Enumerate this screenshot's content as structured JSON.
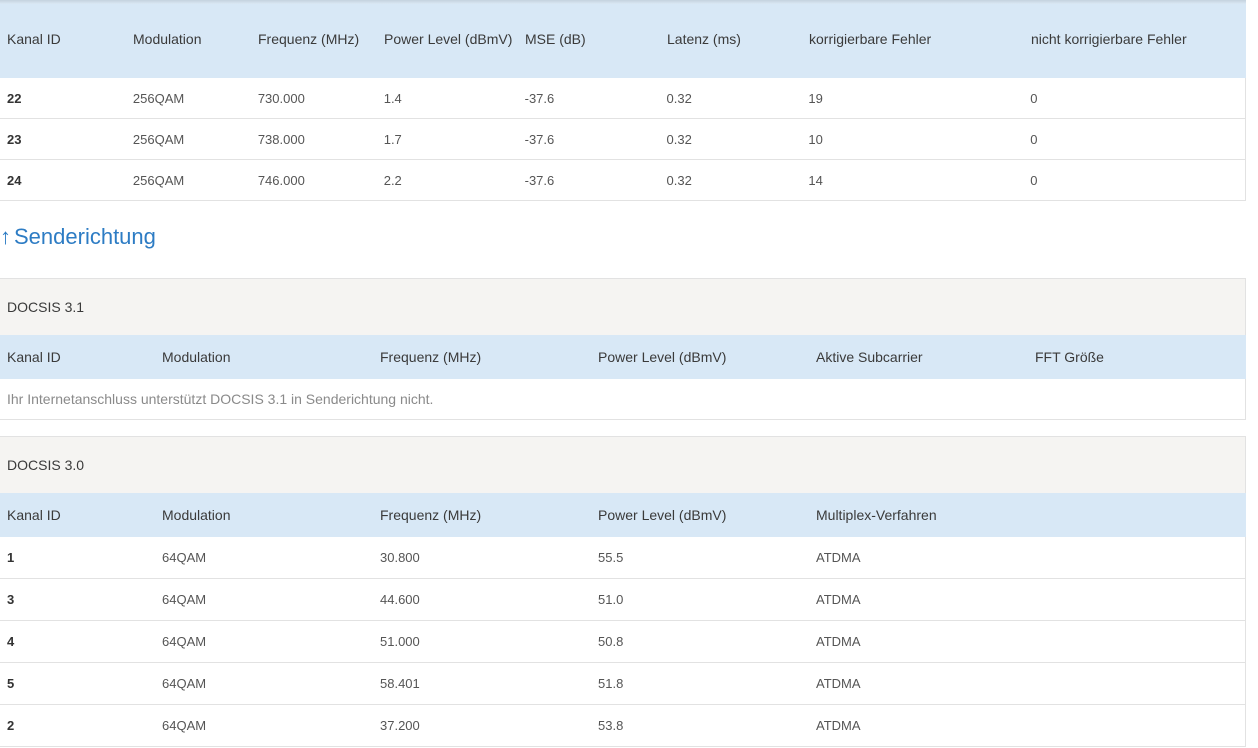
{
  "downstream": {
    "headers": [
      "Kanal ID",
      "Modulation",
      "Frequenz (MHz)",
      "Power Level (dBmV)",
      "MSE (dB)",
      "Latenz (ms)",
      "korrigierbare Fehler",
      "nicht korrigierbare Fehler"
    ],
    "rows": [
      [
        "22",
        "256QAM",
        "730.000",
        "1.4",
        "-37.6",
        "0.32",
        "19",
        "0"
      ],
      [
        "23",
        "256QAM",
        "738.000",
        "1.7",
        "-37.6",
        "0.32",
        "10",
        "0"
      ],
      [
        "24",
        "256QAM",
        "746.000",
        "2.2",
        "-37.6",
        "0.32",
        "14",
        "0"
      ]
    ]
  },
  "upstream": {
    "heading": "Senderichtung",
    "arrow_icon": "arrow-up-icon",
    "docsis31": {
      "title": "DOCSIS 3.1",
      "headers": [
        "Kanal ID",
        "Modulation",
        "Frequenz (MHz)",
        "Power Level (dBmV)",
        "Aktive Subcarrier",
        "FFT Größe"
      ],
      "notice": "Ihr Internetanschluss unterstützt DOCSIS 3.1 in Senderichtung nicht."
    },
    "docsis30": {
      "title": "DOCSIS 3.0",
      "headers": [
        "Kanal ID",
        "Modulation",
        "Frequenz (MHz)",
        "Power Level (dBmV)",
        "Multiplex-Verfahren"
      ],
      "rows": [
        [
          "1",
          "64QAM",
          "30.800",
          "55.5",
          "ATDMA"
        ],
        [
          "3",
          "64QAM",
          "44.600",
          "51.0",
          "ATDMA"
        ],
        [
          "4",
          "64QAM",
          "51.000",
          "50.8",
          "ATDMA"
        ],
        [
          "5",
          "64QAM",
          "58.401",
          "51.8",
          "ATDMA"
        ],
        [
          "2",
          "64QAM",
          "37.200",
          "53.8",
          "ATDMA"
        ]
      ]
    }
  },
  "colors": {
    "header_bg": "#d8e8f6",
    "heading_blue": "#2d7cc4",
    "group_bg": "#f5f4f2"
  }
}
